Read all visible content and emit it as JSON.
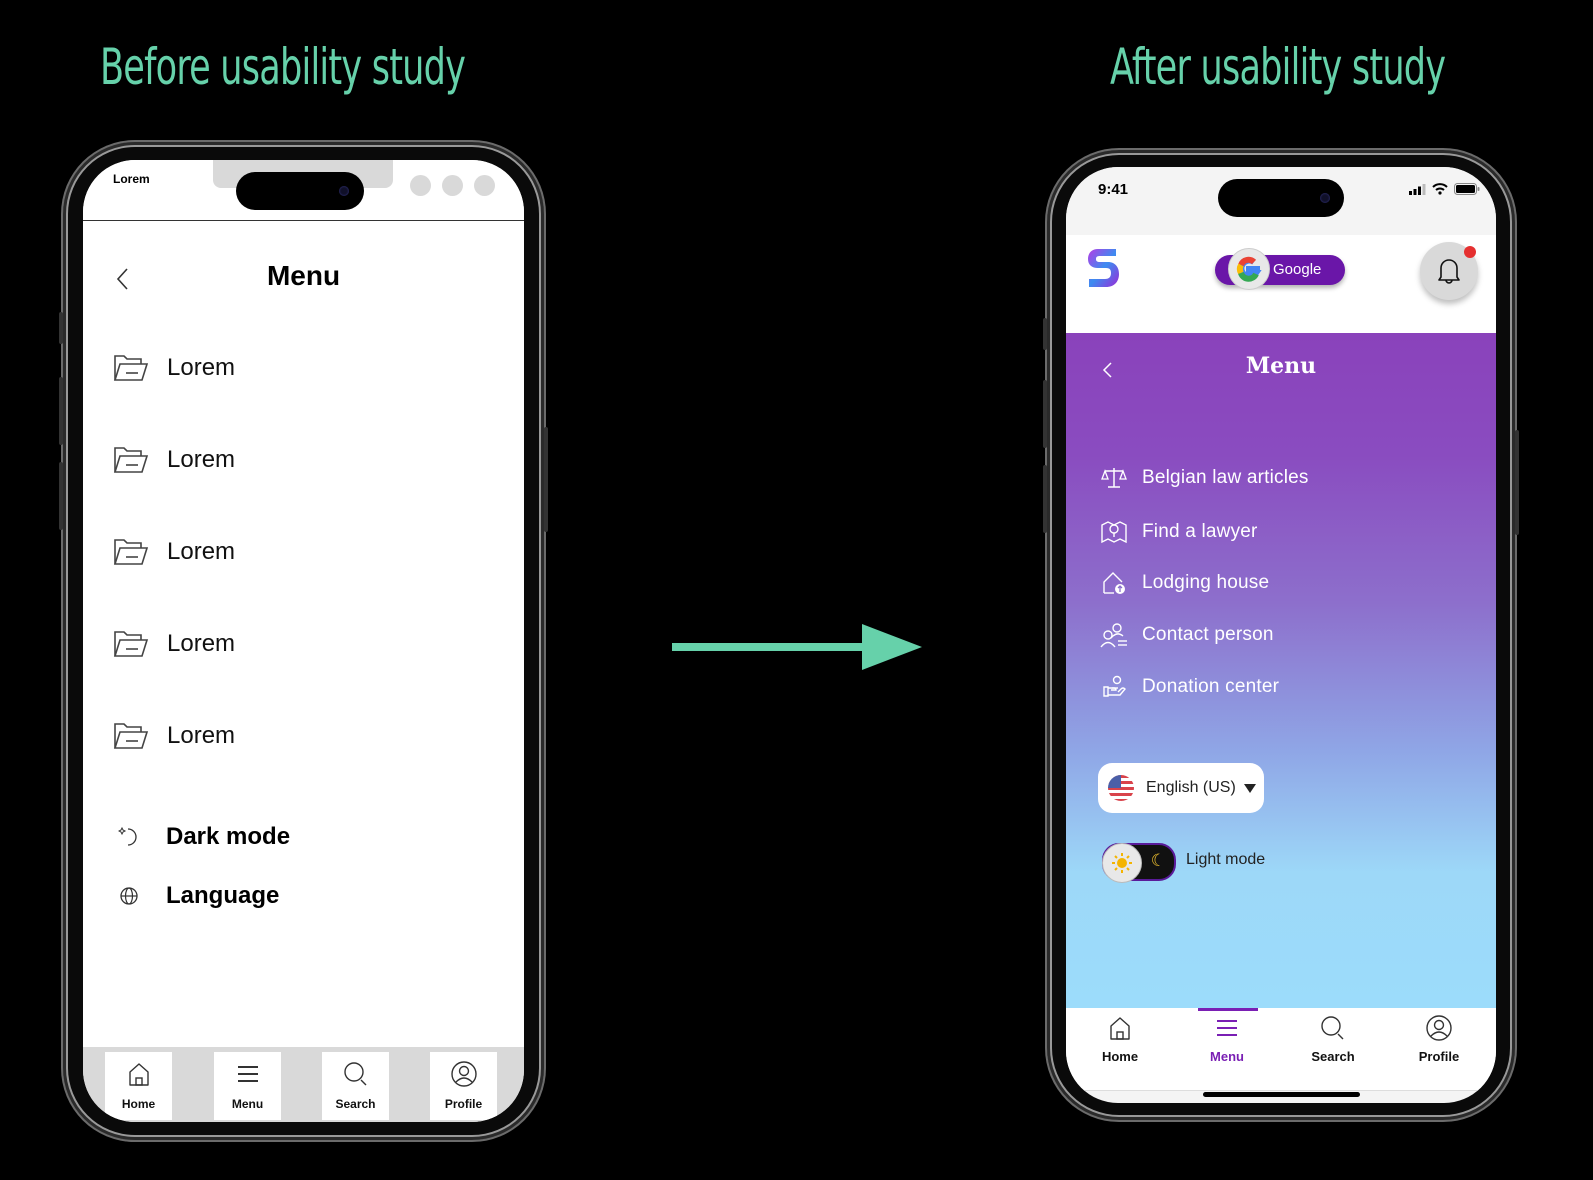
{
  "headings": {
    "before": "Before usability study",
    "after": "After usability study"
  },
  "colors": {
    "accent_green": "#66d1aa",
    "brand_purple": "#7a1fb4",
    "gradient_top": "#8a42bb",
    "gradient_bottom": "#9cdcfb",
    "notification_red": "#e53030"
  },
  "before": {
    "status_text": "Lorem",
    "title": "Menu",
    "back_icon": "chevron-left-icon",
    "items": [
      {
        "label": "Lorem",
        "icon": "folder-open-icon"
      },
      {
        "label": "Lorem",
        "icon": "folder-open-icon"
      },
      {
        "label": "Lorem",
        "icon": "folder-open-icon"
      },
      {
        "label": "Lorem",
        "icon": "folder-open-icon"
      },
      {
        "label": "Lorem",
        "icon": "folder-open-icon"
      }
    ],
    "settings": [
      {
        "label": "Dark mode",
        "icon": "moon-icon"
      },
      {
        "label": "Language",
        "icon": "globe-icon"
      }
    ],
    "tabs": [
      {
        "label": "Home",
        "icon": "home-icon"
      },
      {
        "label": "Menu",
        "icon": "menu-icon"
      },
      {
        "label": "Search",
        "icon": "search-icon"
      },
      {
        "label": "Profile",
        "icon": "profile-icon"
      }
    ]
  },
  "after": {
    "status_time": "9:41",
    "google_label": "Google",
    "title": "Menu",
    "items": [
      {
        "label": "Belgian law articles",
        "icon": "scale-icon"
      },
      {
        "label": "Find a lawyer",
        "icon": "map-pin-icon"
      },
      {
        "label": "Lodging house",
        "icon": "house-icon"
      },
      {
        "label": "Contact person",
        "icon": "contacts-icon"
      },
      {
        "label": "Donation center",
        "icon": "donation-icon"
      }
    ],
    "language": {
      "selected": "English (US)",
      "flag": "us-flag-icon"
    },
    "theme_toggle": {
      "label": "Light mode",
      "state": "light"
    },
    "tabs": [
      {
        "label": "Home",
        "icon": "home-icon"
      },
      {
        "label": "Menu",
        "icon": "menu-icon",
        "active": true
      },
      {
        "label": "Search",
        "icon": "search-icon"
      },
      {
        "label": "Profile",
        "icon": "profile-icon"
      }
    ]
  }
}
